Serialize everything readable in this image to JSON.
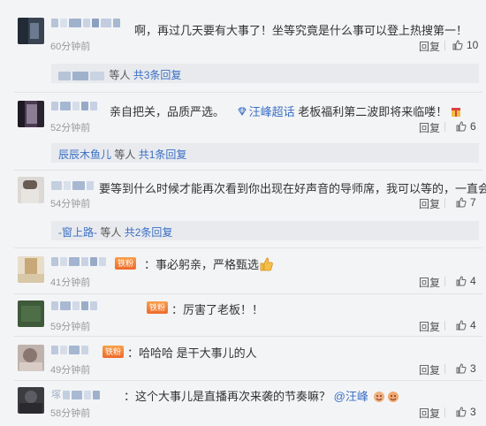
{
  "comments": [
    {
      "text": "啊，再过几天要有大事了！坐等究竟是什么事可以登上热搜第一！",
      "time": "60分钟前",
      "reply_label": "回复",
      "likes": "10",
      "sub": {
        "prefix": "",
        "link_user": "",
        "mid": "等人",
        "link_count": "共3条回复"
      }
    },
    {
      "text_before": "亲自把关，品质严选。",
      "topic": "汪峰超话",
      "text_after": "老板福利第二波即将来临喽！",
      "time": "52分钟前",
      "reply_label": "回复",
      "likes": "6",
      "sub": {
        "link_user": "辰辰木鱼儿",
        "mid": "等人",
        "link_count": "共1条回复"
      }
    },
    {
      "text": "要等到什么时候才能再次看到你出现在好声音的导师席，我可以等的，一直会的",
      "time": "54分钟前",
      "reply_label": "回复",
      "likes": "7",
      "sub": {
        "link_user": "-窗上路-",
        "mid": "等人",
        "link_count": "共2条回复"
      }
    },
    {
      "badge": "铁粉",
      "text": "：事必躬亲，严格甄选",
      "time": "41分钟前",
      "reply_label": "回复",
      "likes": "4"
    },
    {
      "badge": "铁粉",
      "text": "：厉害了老板！！",
      "time": "59分钟前",
      "reply_label": "回复",
      "likes": "4"
    },
    {
      "badge": "铁粉",
      "text": "：哈哈哈 是干大事儿的人",
      "time": "49分钟前",
      "reply_label": "回复",
      "likes": "3"
    },
    {
      "name_prefix": "塚",
      "text": "：这个大事儿是直播再次来袭的节奏嘛？",
      "mention": "@汪峰",
      "time": "58分钟前",
      "reply_label": "回复",
      "likes": "3"
    }
  ],
  "colors": {
    "link": "#3a6fc4",
    "bg": "#f3f4f6",
    "badge": "#ef6a2a"
  },
  "icons": {
    "like": "thumbs-up-icon",
    "topic": "diamond-icon"
  }
}
